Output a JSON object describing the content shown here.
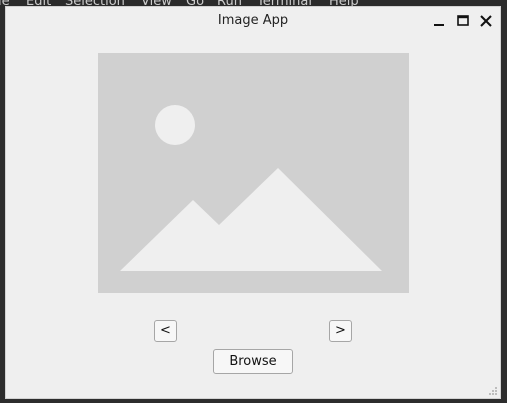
{
  "background_editor": {
    "menu": [
      "le",
      "Edit",
      "Selection",
      "View",
      "Go",
      "Run",
      "Terminal",
      "Help"
    ]
  },
  "window": {
    "title": "Image App",
    "controls": {
      "minimize_icon": "minimize-icon",
      "maximize_icon": "maximize-icon",
      "close_icon": "close-icon"
    }
  },
  "image_viewer": {
    "placeholder_icon": "image-placeholder-icon"
  },
  "navigation": {
    "prev_label": "<",
    "next_label": ">"
  },
  "actions": {
    "browse_label": "Browse"
  },
  "colors": {
    "window_bg": "#efefef",
    "image_bg": "#d0d0d0",
    "placeholder_fg": "#efefef",
    "editor_bg": "#1e1f22"
  }
}
